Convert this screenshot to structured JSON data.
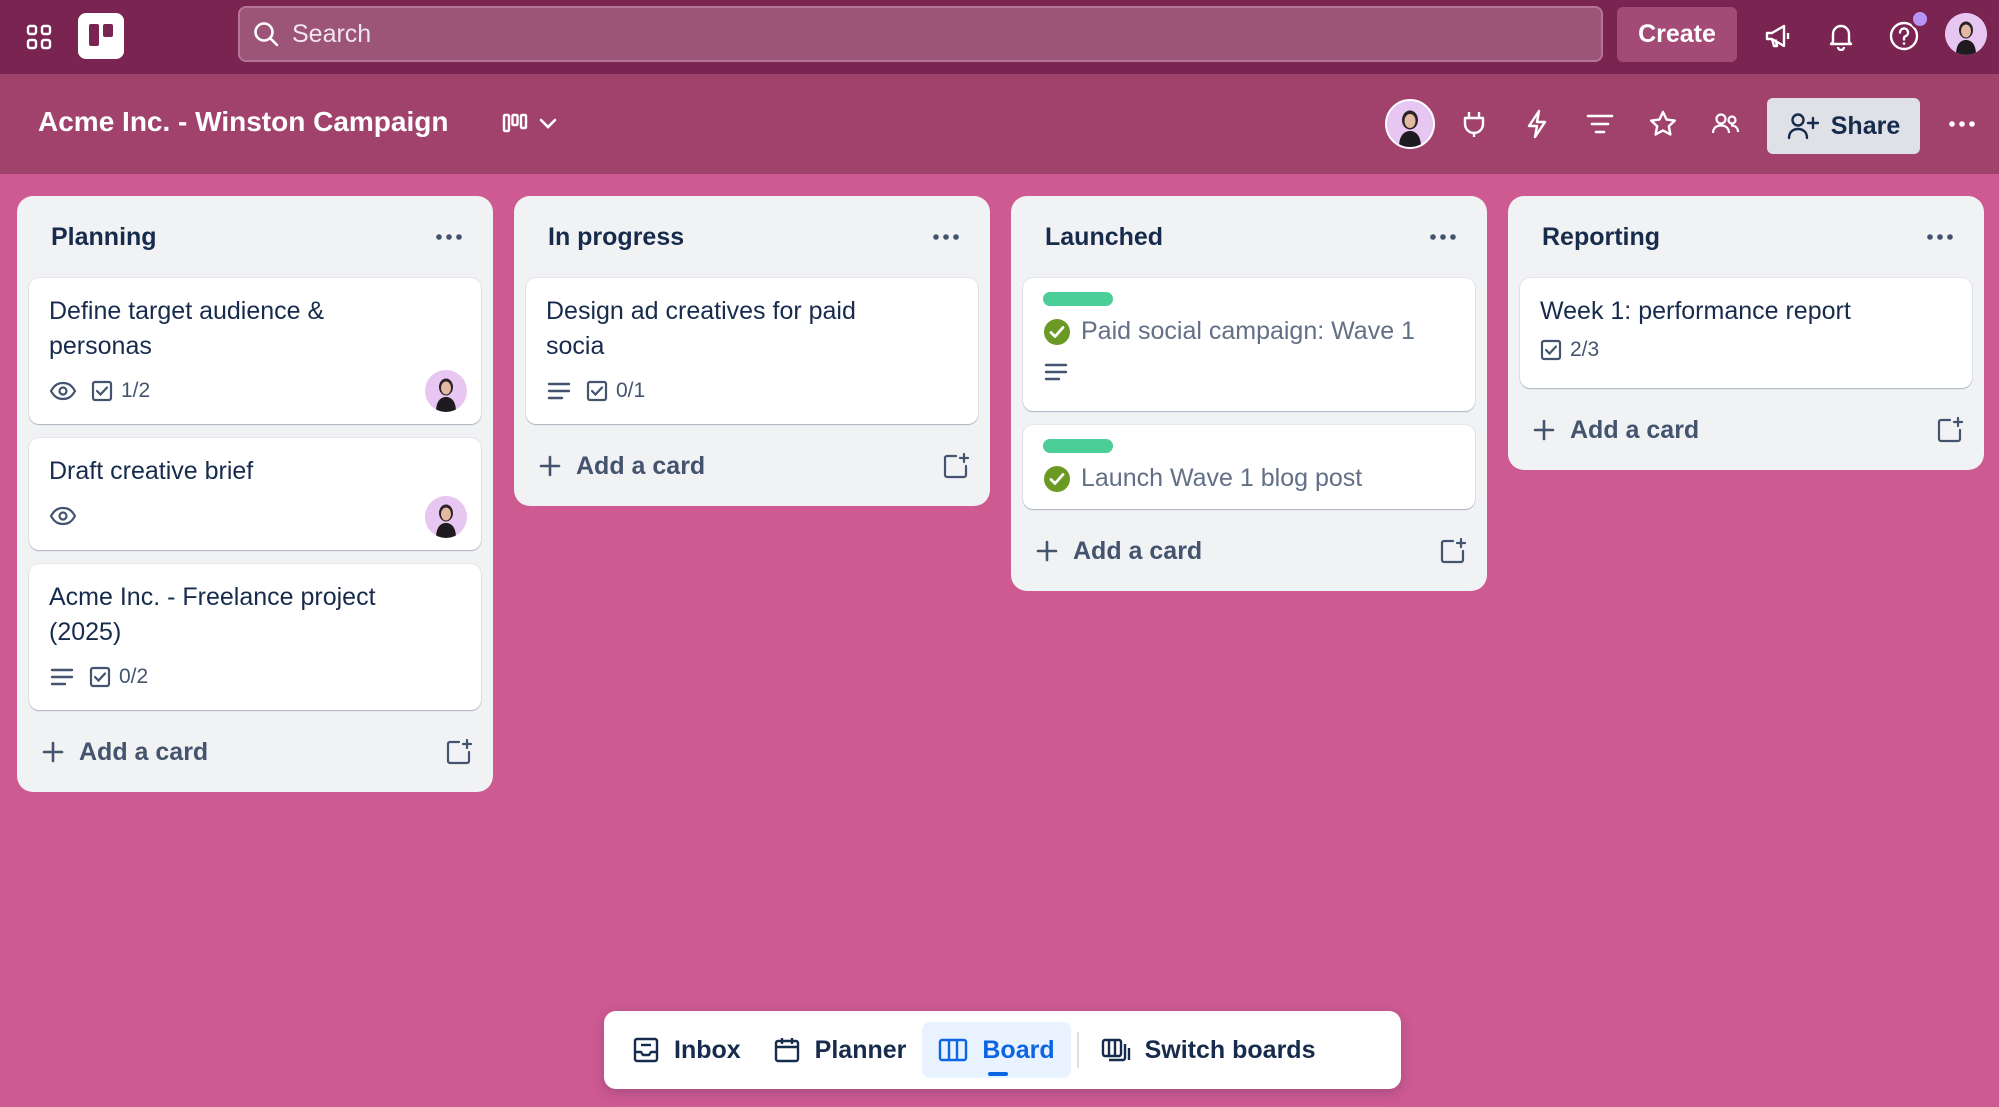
{
  "topnav": {
    "search_placeholder": "Search",
    "create_label": "Create",
    "icons": [
      "apps-grid-icon",
      "trello-logo",
      "search-icon",
      "megaphone-icon",
      "bell-icon",
      "help-icon",
      "user-avatar"
    ]
  },
  "board": {
    "title": "Acme Inc. - Winston Campaign",
    "share_label": "Share",
    "header_icons": [
      "board-view-icon",
      "chevron-down-icon",
      "member-avatar",
      "power-ups-icon",
      "automation-icon",
      "filter-icon",
      "star-icon",
      "visibility-icon",
      "more-icon"
    ]
  },
  "lists": [
    {
      "title": "Planning",
      "cards": [
        {
          "title": "Define target audience & personas",
          "checklist": "1/2"
        },
        {
          "title": "Draft creative brief"
        },
        {
          "title": "Acme Inc. - Freelance project (2025)",
          "checklist": "0/2"
        }
      ],
      "add_label": "Add a card"
    },
    {
      "title": "In progress",
      "cards": [
        {
          "title": "Design ad creatives for paid socia",
          "checklist": "0/1"
        }
      ],
      "add_label": "Add a card"
    },
    {
      "title": "Launched",
      "cards": [
        {
          "title": "Paid social campaign: Wave 1",
          "label_color": "#4bce97",
          "complete": true
        },
        {
          "title": "Launch Wave 1 blog post",
          "label_color": "#4bce97",
          "complete": true
        }
      ],
      "add_label": "Add a card"
    },
    {
      "title": "Reporting",
      "cards": [
        {
          "title": "Week 1: performance report",
          "checklist": "2/3"
        }
      ],
      "add_label": "Add a card"
    }
  ],
  "switcher": {
    "items": [
      {
        "label": "Inbox",
        "icon": "inbox-icon"
      },
      {
        "label": "Planner",
        "icon": "calendar-icon"
      },
      {
        "label": "Board",
        "icon": "board-icon",
        "active": true
      },
      {
        "label": "Switch boards",
        "icon": "switch-boards-icon"
      }
    ]
  },
  "colors": {
    "topnav_bg": "#7a2452",
    "boardbar_bg": "#a1426d",
    "board_bg": "#cd5a91",
    "accent": "#0c66e4",
    "label_green": "#4bce97",
    "complete_green": "#6a9a23"
  }
}
